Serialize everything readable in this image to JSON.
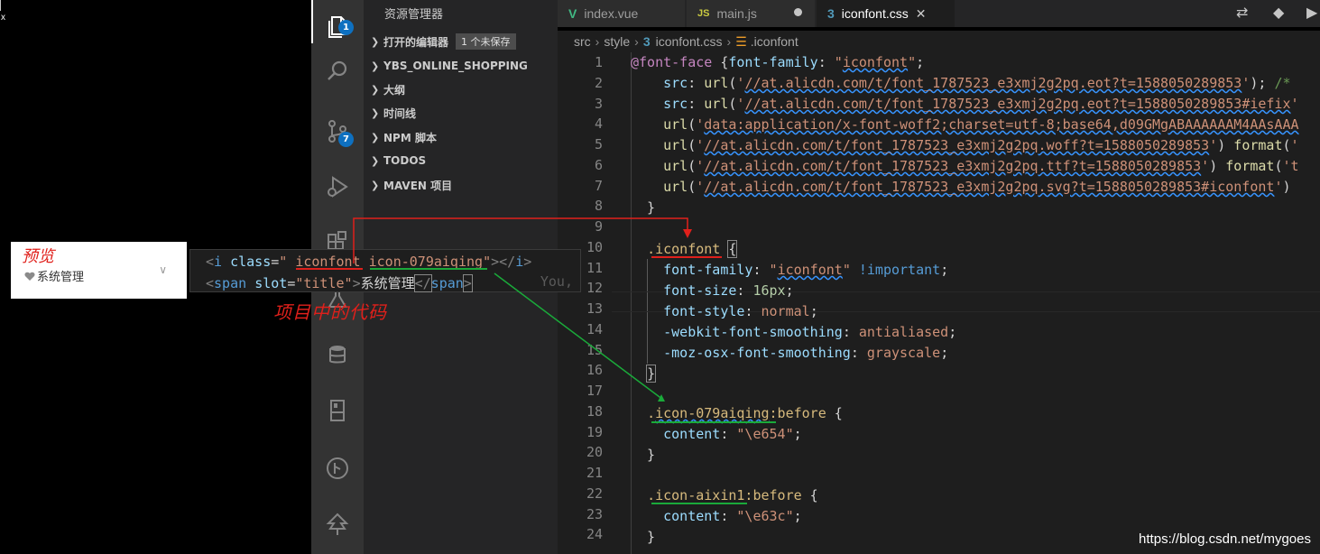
{
  "left_strip": {
    "glyph": "x"
  },
  "activity_bar": {
    "explorer_badge": "1",
    "scm_badge": "7"
  },
  "explorer": {
    "title": "资源管理器",
    "open_editors": {
      "label": "打开的编辑器",
      "unsaved": "1 个未保存"
    },
    "sections": [
      "YBS_ONLINE_SHOPPING",
      "大纲",
      "时间线",
      "NPM 脚本",
      "TODOS",
      "MAVEN 项目"
    ]
  },
  "tabs": [
    {
      "label": "index.vue",
      "icon": "vue-icon",
      "glyph": "V",
      "color": "#41b883"
    },
    {
      "label": "main.js",
      "icon": "js-icon",
      "glyph": "JS",
      "color": "#cbcb41"
    },
    {
      "label": "iconfont.css",
      "icon": "css-icon",
      "glyph": "3",
      "color": "#519aba"
    }
  ],
  "breadcrumb": {
    "parts": [
      "src",
      "style",
      "iconfont.css",
      ".iconfont"
    ]
  },
  "editor": {
    "line_numbers": [
      "1",
      "2",
      "3",
      "4",
      "5",
      "6",
      "7",
      "8",
      "9",
      "10",
      "11",
      "12",
      "13",
      "14",
      "15",
      "16",
      "17",
      "18",
      "19",
      "20",
      "21",
      "22",
      "23",
      "24"
    ]
  },
  "preview": {
    "label": "预览",
    "menu_text": "系统管理"
  },
  "snippet": {
    "line1": {
      "open": "<",
      "tag": "i",
      "attr": "class",
      "eq": "=",
      "q1": "\"",
      "v1": "iconfont",
      "v2": "icon-079aiqing",
      "q2": "\"",
      "close": "></",
      "tag2": "i",
      "end": ">"
    },
    "line2": {
      "open": "<",
      "tag": "span",
      "attr": "slot",
      "eq": "=",
      "val": "\"title\"",
      "gt": ">",
      "text": "系统管理",
      "close": "</",
      "tag2": "span",
      "end": ">"
    },
    "ghost": "You,"
  },
  "annotation": "项目中的代码",
  "watermark": "https://blog.csdn.net/mygoes"
}
